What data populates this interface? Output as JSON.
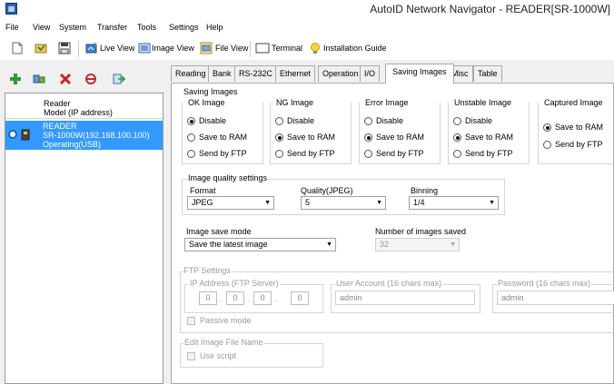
{
  "window": {
    "title": "AutoID Network Navigator - READER[SR-1000W]"
  },
  "menu": [
    "File",
    "View",
    "System",
    "Transfer",
    "Tools",
    "Settings",
    "Help"
  ],
  "toolbar": {
    "live_view": "Live View",
    "image_view": "Image View",
    "file_view": "File View",
    "terminal": "Terminal",
    "installation_guide": "Installation Guide"
  },
  "sidebar": {
    "header_line1": "Reader",
    "header_line2": "Model (IP address)",
    "device": {
      "name": "READER",
      "model_ip": "SR-1000W(192.168.100.100)",
      "status": "Operating(USB)"
    }
  },
  "tabs": [
    "Reading",
    "Bank",
    "RS-232C",
    "Ethernet",
    "Operation",
    "I/O",
    "Saving Images",
    "Misc",
    "Table"
  ],
  "active_tab": "Saving Images",
  "saving_images": {
    "title": "Saving Images",
    "groups": [
      {
        "label": "OK Image",
        "options": [
          "Disable",
          "Save to RAM",
          "Send by FTP"
        ],
        "selected": 0
      },
      {
        "label": "NG Image",
        "options": [
          "Disable",
          "Save to RAM",
          "Send by FTP"
        ],
        "selected": 1
      },
      {
        "label": "Error Image",
        "options": [
          "Disable",
          "Save to RAM",
          "Send by FTP"
        ],
        "selected": 1
      },
      {
        "label": "Unstable Image",
        "options": [
          "Disable",
          "Save to RAM",
          "Send by FTP"
        ],
        "selected": 1
      },
      {
        "label": "Captured Image",
        "options": [
          "Save to RAM",
          "Send by FTP"
        ],
        "selected": 0
      }
    ],
    "quality": {
      "title": "Image quality settings",
      "format_label": "Format",
      "format_value": "JPEG",
      "quality_label": "Quality(JPEG)",
      "quality_value": "5",
      "binning_label": "Binning",
      "binning_value": "1/4"
    },
    "save_mode_label": "Image save mode",
    "save_mode_value": "Save the latest image",
    "num_images_label": "Number of images saved",
    "num_images_value": "32"
  },
  "ftp": {
    "title": "FTP Settings",
    "ip_label": "IP Address (FTP Server)",
    "ip": [
      "0",
      "0",
      "0",
      "0"
    ],
    "user_label": "User Account (16 chars max)",
    "user_value": "admin",
    "password_label": "Password (16 chars max)",
    "password_value": "admin",
    "passive_label": "Passive mode"
  },
  "edit_name": {
    "title": "Edit Image File Name",
    "use_script_label": "Use script"
  }
}
